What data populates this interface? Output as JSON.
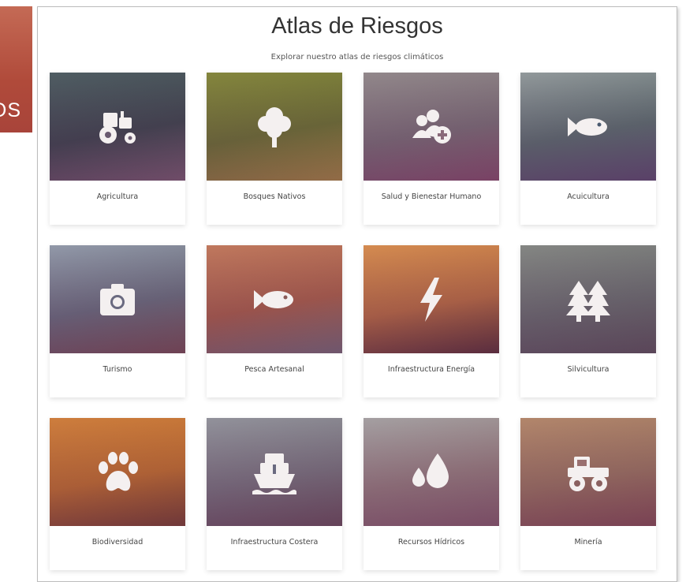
{
  "side_banner": {
    "text": "OS"
  },
  "header": {
    "title": "Atlas de Riesgos",
    "subtitle": "Explorar nuestro atlas de riesgos climáticos"
  },
  "cards": [
    {
      "label": "Agricultura",
      "icon": "tractor-icon",
      "colors": [
        "#3c5a66",
        "#2a3e4c",
        "#6b5a70"
      ]
    },
    {
      "label": "Bosques Nativos",
      "icon": "tree-icon",
      "colors": [
        "#7a8a3a",
        "#5c6e2e",
        "#a08a3c"
      ]
    },
    {
      "label": "Salud y Bienestar Humano",
      "icon": "users-plus-icon",
      "colors": [
        "#8a8c95",
        "#6c6a78",
        "#7a4a6a"
      ]
    },
    {
      "label": "Acuicultura",
      "icon": "fish-icon",
      "colors": [
        "#8aa0a8",
        "#4a6a70",
        "#4a4870"
      ]
    },
    {
      "label": "Turismo",
      "icon": "camera-icon",
      "colors": [
        "#8aa0b8",
        "#5a6a80",
        "#6a4a50"
      ]
    },
    {
      "label": "Pesca Artesanal",
      "icon": "fish-icon",
      "colors": [
        "#c07a60",
        "#a05a48",
        "#6a6a78"
      ]
    },
    {
      "label": "Infraestructura Energía",
      "icon": "bolt-icon",
      "colors": [
        "#d89050",
        "#b06840",
        "#4a2a30"
      ]
    },
    {
      "label": "Silvicultura",
      "icon": "pine-trees-icon",
      "colors": [
        "#7a8a8c",
        "#5a6a70",
        "#4a5058"
      ]
    },
    {
      "label": "Biodiversidad",
      "icon": "paw-icon",
      "colors": [
        "#d0803a",
        "#b86a2a",
        "#6a3a28"
      ]
    },
    {
      "label": "Infraestructura Costera",
      "icon": "ship-icon",
      "colors": [
        "#8a98a8",
        "#6a7080",
        "#5a4a58"
      ]
    },
    {
      "label": "Recursos Hídricos",
      "icon": "droplets-icon",
      "colors": [
        "#a0a8b0",
        "#8a7a80",
        "#7a5a6a"
      ]
    },
    {
      "label": "Minería",
      "icon": "truck-icon",
      "colors": [
        "#b08a70",
        "#907060",
        "#7a4a50"
      ]
    }
  ]
}
